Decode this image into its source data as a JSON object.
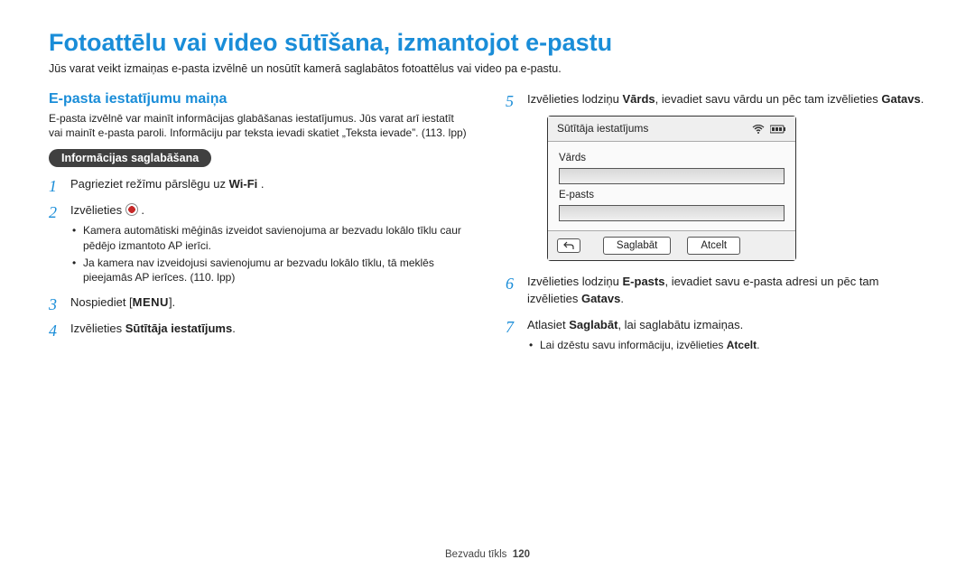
{
  "title": "Fotoattēlu vai video sūtīšana, izmantojot e-pastu",
  "intro": "Jūs varat veikt izmaiņas e-pasta izvēlnē un nosūtīt kamerā saglabātos fotoattēlus vai video pa e-pastu.",
  "left": {
    "subheading": "E-pasta iestatījumu maiņa",
    "subdesc": "E-pasta izvēlnē var mainīt informācijas glabāšanas iestatījumus. Jūs varat arī iestatīt vai mainīt e-pasta paroli. Informāciju par teksta ievadi skatiet „Teksta ievade”. (113. lpp)",
    "pill": "Informācijas saglabāšana",
    "step1_a": "Pagrieziet režīmu pārslēgu uz ",
    "step1_wifi": "Wi-Fi",
    "step1_b": " .",
    "step2_a": "Izvēlieties ",
    "step2_b": " .",
    "bullet2a": "Kamera automātiski mēģinās izveidot savienojuma ar bezvadu lokālo tīklu caur pēdējo izmantoto AP ierīci.",
    "bullet2b": "Ja kamera nav izveidojusi savienojumu ar bezvadu lokālo tīklu, tā meklēs pieejamās AP ierīces. (110. lpp)",
    "step3_a": "Nospiediet [",
    "step3_menu": "MENU",
    "step3_b": "].",
    "step4_a": "Izvēlieties ",
    "step4_bold": "Sūtītāja iestatījums",
    "step4_b": "."
  },
  "right": {
    "step5_a": "Izvēlieties lodziņu ",
    "step5_bold1": "Vārds",
    "step5_b": ", ievadiet savu vārdu un pēc tam izvēlieties ",
    "step5_bold2": "Gatavs",
    "step5_c": ".",
    "device": {
      "title": "Sūtītāja iestatījums",
      "field1": "Vārds",
      "field2": "E-pasts",
      "btn_save": "Saglabāt",
      "btn_cancel": "Atcelt"
    },
    "step6_a": "Izvēlieties lodziņu ",
    "step6_bold1": "E-pasts",
    "step6_b": ", ievadiet savu e-pasta adresi un pēc tam izvēlieties ",
    "step6_bold2": "Gatavs",
    "step6_c": ".",
    "step7_a": "Atlasiet ",
    "step7_bold": "Saglabāt",
    "step7_b": ", lai saglabātu izmaiņas.",
    "bullet7_a": "Lai dzēstu savu informāciju, izvēlieties ",
    "bullet7_bold": "Atcelt",
    "bullet7_b": "."
  },
  "footer": {
    "section": "Bezvadu tīkls",
    "page": "120"
  }
}
